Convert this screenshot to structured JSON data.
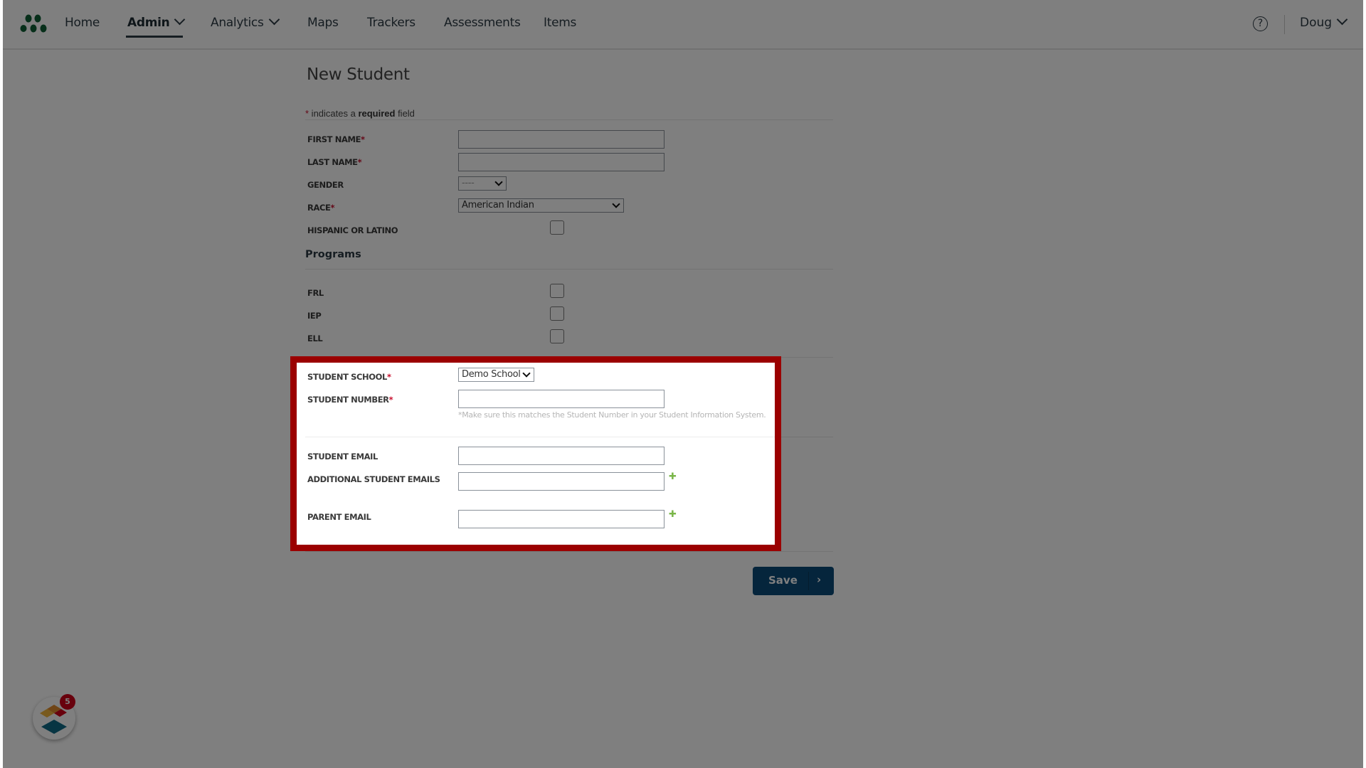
{
  "nav": {
    "items": [
      {
        "label": "Home",
        "active": false,
        "dropdown": false
      },
      {
        "label": "Admin",
        "active": true,
        "dropdown": true
      },
      {
        "label": "Analytics",
        "active": false,
        "dropdown": true
      },
      {
        "label": "Maps",
        "active": false,
        "dropdown": false
      },
      {
        "label": "Trackers",
        "active": false,
        "dropdown": false
      },
      {
        "label": "Assessments",
        "active": false,
        "dropdown": false
      },
      {
        "label": "Items",
        "active": false,
        "dropdown": false
      }
    ],
    "help_icon": "question-circle",
    "help_glyph": "?",
    "user_name": "Doug"
  },
  "form": {
    "title": "New Student",
    "required_note": {
      "star": "*",
      "prefix": " indicates a ",
      "bold": "required",
      "suffix": " field"
    },
    "required_marker": "*",
    "fields": {
      "first_name": {
        "label": "FIRST NAME",
        "value": ""
      },
      "last_name": {
        "label": "LAST NAME",
        "value": ""
      },
      "gender": {
        "label": "GENDER",
        "value": "----"
      },
      "race": {
        "label": "RACE",
        "value": "American Indian"
      },
      "hispanic": {
        "label": "HISPANIC OR LATINO",
        "checked": false
      }
    },
    "programs": {
      "heading": "Programs",
      "items": [
        {
          "label": "FRL",
          "checked": false
        },
        {
          "label": "IEP",
          "checked": false
        },
        {
          "label": "ELL",
          "checked": false
        }
      ]
    },
    "school": {
      "student_school": {
        "label": "STUDENT SCHOOL",
        "value": "Demo School"
      },
      "student_number": {
        "label": "STUDENT NUMBER",
        "value": "",
        "hint": "*Make sure this matches the Student Number in your Student Information System."
      }
    },
    "emails": {
      "student_email": {
        "label": "STUDENT EMAIL",
        "value": ""
      },
      "additional_emails": {
        "label": "ADDITIONAL STUDENT EMAILS",
        "value": ""
      },
      "parent_email": {
        "label": "PARENT EMAIL",
        "value": ""
      },
      "add_glyph": "✚"
    },
    "save_label": "Save",
    "save_arrow": "›"
  },
  "widget": {
    "badge_count": "5"
  },
  "colors": {
    "highlight": "#9b0000",
    "save_button": "#0b4b79",
    "required_star": "#c8102e",
    "add_icon": "#7ab648",
    "logo": "#0e5e35"
  }
}
